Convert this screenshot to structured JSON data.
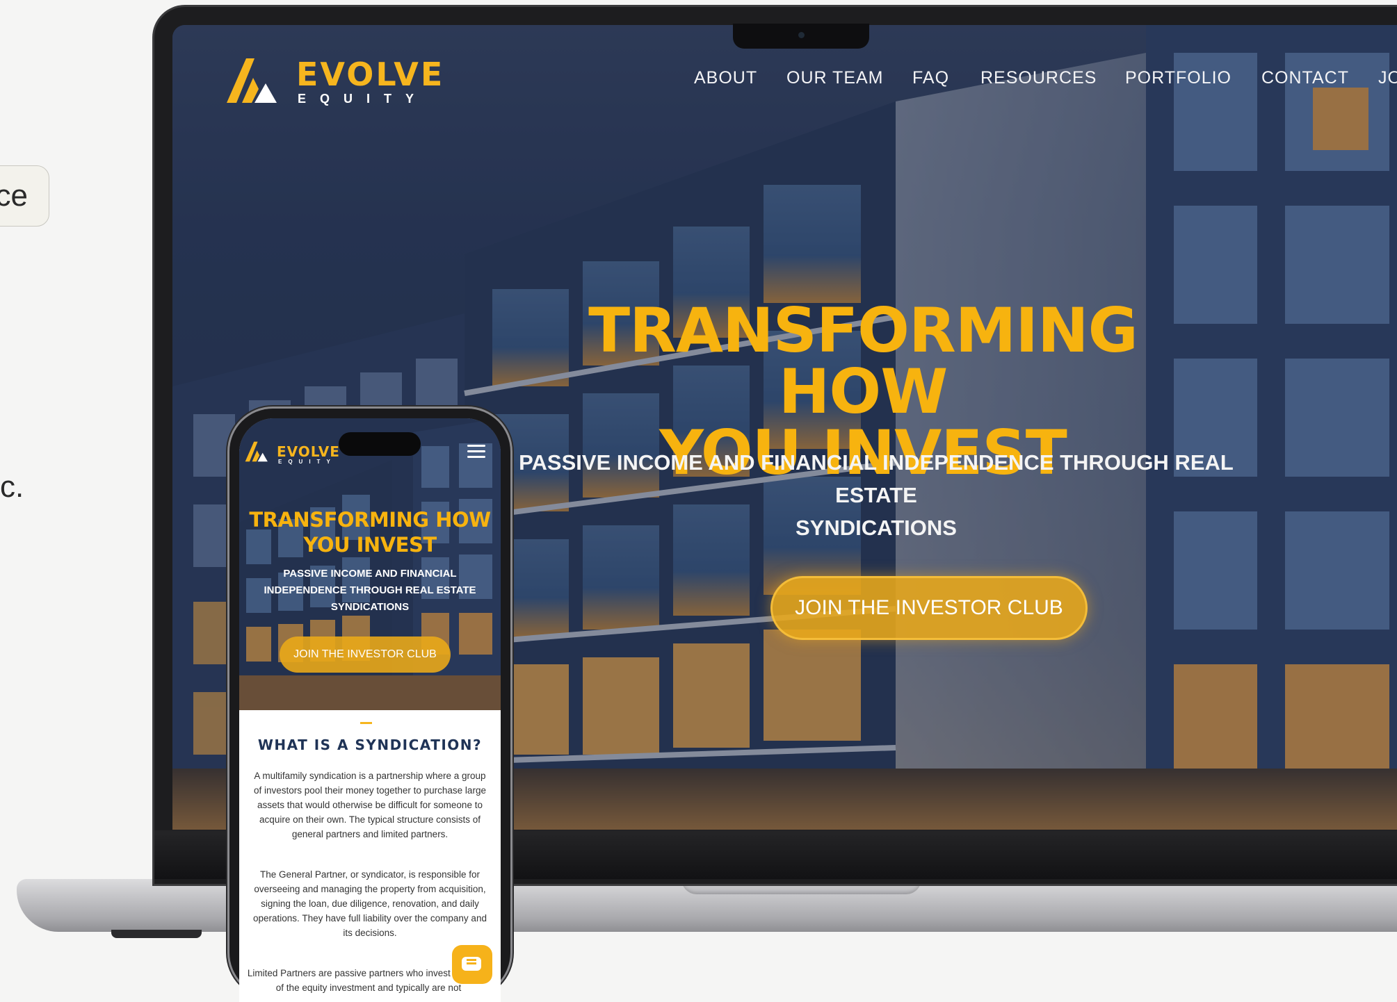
{
  "left_fragments": {
    "pill_text": "ce",
    "text": "c."
  },
  "laptop": {
    "logo": {
      "word": "EVOLVE",
      "sub": "EQUITY"
    },
    "nav": [
      "ABOUT",
      "OUR TEAM",
      "FAQ",
      "RESOURCES",
      "PORTFOLIO",
      "CONTACT",
      "JO"
    ],
    "hero": {
      "title_line1": "TRANSFORMING HOW",
      "title_line2": "YOU INVEST",
      "subtitle_line1": "PASSIVE INCOME AND FINANCIAL INDEPENDENCE THROUGH REAL ESTATE",
      "subtitle_line2": "SYNDICATIONS",
      "cta": "JOIN THE INVESTOR CLUB"
    }
  },
  "phone": {
    "logo": {
      "word": "EVOLVE",
      "sub": "EQUITY"
    },
    "hero": {
      "title_line1": "TRANSFORMING HOW",
      "title_line2": "YOU INVEST",
      "subtitle_line1": "PASSIVE INCOME AND FINANCIAL",
      "subtitle_line2": "INDEPENDENCE THROUGH REAL ESTATE",
      "subtitle_line3": "SYNDICATIONS",
      "cta": "JOIN THE INVESTOR CLUB"
    },
    "section": {
      "heading": "WHAT IS A SYNDICATION?",
      "para1": "A multifamily syndication is a partnership where a group of investors pool their money together to purchase large assets that would otherwise be difficult for someone to acquire on their own. The typical structure consists of general partners and limited partners.",
      "para2": "The General Partner, or syndicator, is responsible for overseeing and managing the property from acquisition, signing the loan, due diligence, renovation, and daily operations. They have full liability over the company and its decisions.",
      "para3": "Limited Partners are passive partners who invest a portion of the equity investment and typically are not"
    }
  },
  "colors": {
    "accent": "#f6b51e",
    "heading_navy": "#1f3356"
  },
  "icons": [
    "menu-icon",
    "chat-icon",
    "logo-mark-icon"
  ]
}
